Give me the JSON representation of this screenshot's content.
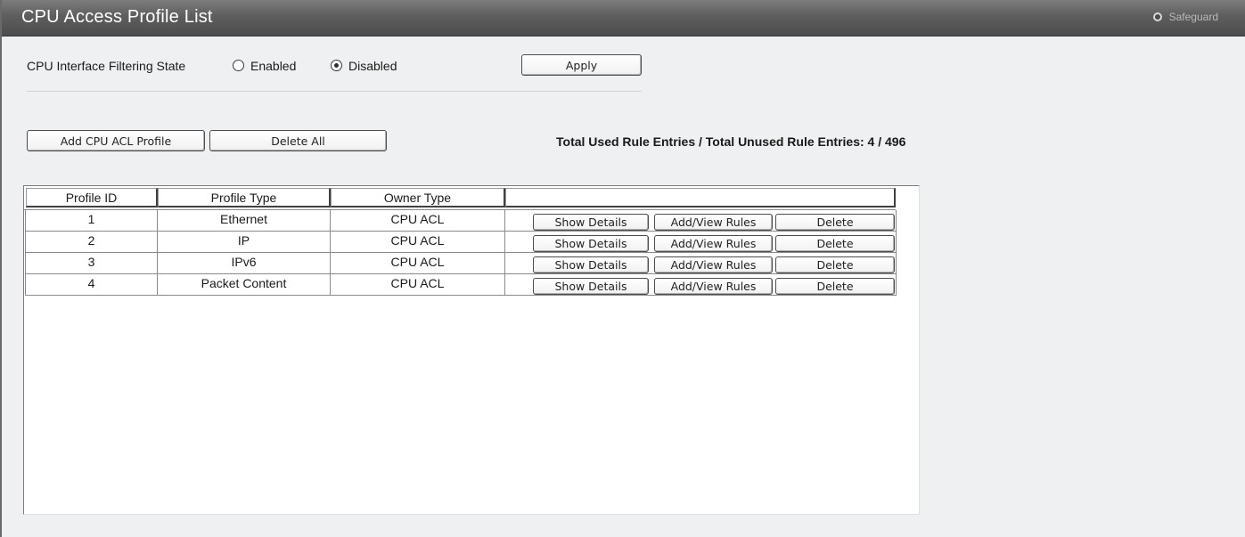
{
  "header": {
    "title": "CPU Access Profile List",
    "safeguard_label": "Safeguard"
  },
  "filtering": {
    "label": "CPU Interface Filtering State",
    "options": [
      {
        "label": "Enabled",
        "selected": false
      },
      {
        "label": "Disabled",
        "selected": true
      }
    ],
    "apply_label": "Apply"
  },
  "actions": {
    "add_label": "Add CPU ACL Profile",
    "delete_all_label": "Delete All"
  },
  "stats": {
    "text": "Total Used Rule Entries / Total Unused Rule Entries: 4 / 496"
  },
  "table": {
    "headers": [
      "Profile ID",
      "Profile Type",
      "Owner Type",
      ""
    ],
    "rows": [
      {
        "id": "1",
        "type": "Ethernet",
        "owner": "CPU ACL"
      },
      {
        "id": "2",
        "type": "IP",
        "owner": "CPU ACL"
      },
      {
        "id": "3",
        "type": "IPv6",
        "owner": "CPU ACL"
      },
      {
        "id": "4",
        "type": "Packet Content",
        "owner": "CPU ACL"
      }
    ],
    "row_buttons": {
      "show_details": "Show Details",
      "add_view_rules": "Add/View Rules",
      "delete": "Delete"
    }
  }
}
